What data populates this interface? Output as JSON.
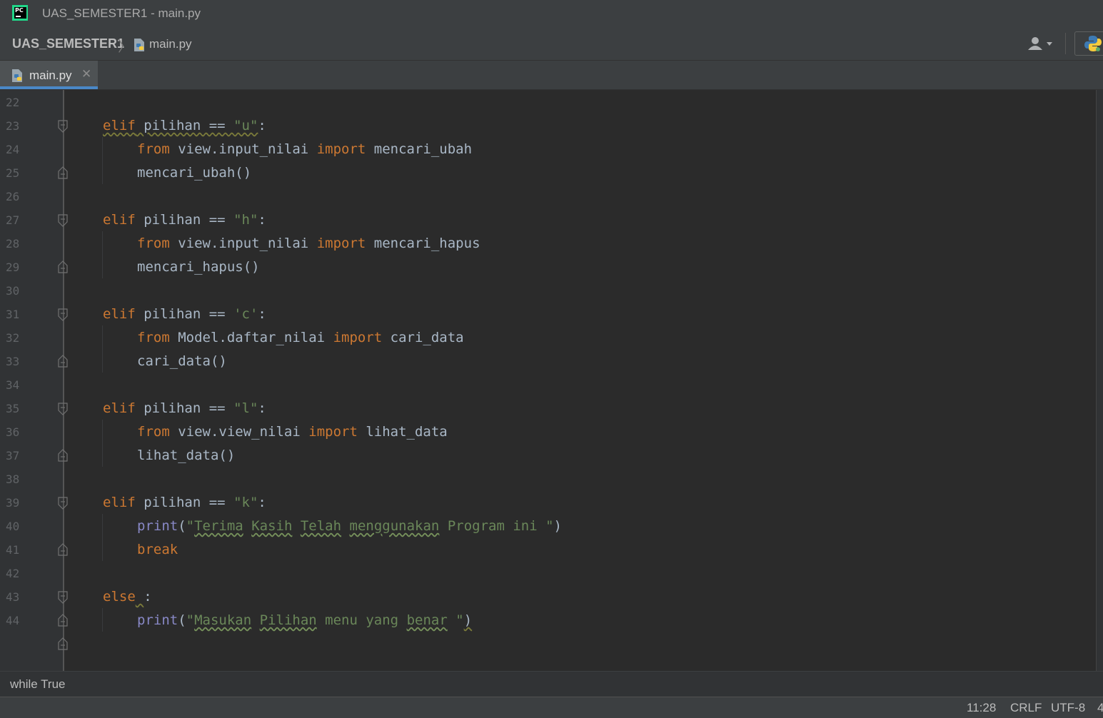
{
  "window": {
    "app_icon": "pycharm-logo-icon",
    "app_icon_text": "PC",
    "title": "UAS_SEMESTER1 - main.py"
  },
  "navbar": {
    "project": "UAS_SEMESTER1",
    "file": "main.py",
    "file_icon": "python-file-icon",
    "user_icon": "user-dropdown-icon",
    "interpreter_icon": "python-icon"
  },
  "tabs": [
    {
      "label": "main.py",
      "icon": "python-file-icon",
      "close": "✕",
      "active": true
    }
  ],
  "editor": {
    "line_numbers": [
      "22",
      "23",
      "24",
      "25",
      "26",
      "27",
      "28",
      "29",
      "30",
      "31",
      "32",
      "33",
      "34",
      "35",
      "36",
      "37",
      "38",
      "39",
      "40",
      "41",
      "42",
      "43",
      "44"
    ],
    "colors": {
      "background": "#2b2b2b",
      "keyword": "#cc7832",
      "string": "#6a8759",
      "builtin": "#8888c6",
      "default": "#a9b7c6",
      "line_number": "#606366"
    },
    "code": {
      "l23": {
        "kw": "elif",
        "rest": "pilihan == ",
        "str": "\"u\"",
        "end": ":"
      },
      "l24": {
        "kw1": "from",
        "mod": "view.input_nilai",
        "kw2": "import",
        "name": "mencari_ubah"
      },
      "l25": {
        "text": "mencari_ubah()"
      },
      "l27": {
        "kw": "elif",
        "rest": "pilihan == ",
        "str": "\"h\"",
        "end": ":"
      },
      "l28": {
        "kw1": "from",
        "mod": "view.input_nilai",
        "kw2": "import",
        "name": "mencari_hapus"
      },
      "l29": {
        "text": "mencari_hapus()"
      },
      "l31": {
        "kw": "elif",
        "rest": "pilihan == ",
        "str": "'c'",
        "end": ":"
      },
      "l32": {
        "kw1": "from",
        "mod": "Model.daftar_nilai",
        "kw2": "import",
        "name": "cari_data"
      },
      "l33": {
        "text": "cari_data()"
      },
      "l35": {
        "kw": "elif",
        "rest": "pilihan == ",
        "str": "\"l\"",
        "end": ":"
      },
      "l36": {
        "kw1": "from",
        "mod": "view.view_nilai",
        "kw2": "import",
        "name": "lihat_data"
      },
      "l37": {
        "text": "lihat_data()"
      },
      "l39": {
        "kw": "elif",
        "rest": "pilihan == ",
        "str": "\"k\"",
        "end": ":"
      },
      "l40": {
        "fn": "print",
        "open": "(",
        "q1": "\"",
        "w1": "Terima",
        "w2": "Kasih",
        "w3": "Telah",
        "w4": "menggunakan",
        "w5": "Program ini ",
        "q2": "\"",
        "close": ")"
      },
      "l41": {
        "kw": "break"
      },
      "l43": {
        "kw": "else",
        "end": ":"
      },
      "l44": {
        "fn": "print",
        "open": "(",
        "q1": "\"",
        "w1": "Masukan",
        "w2": "Pilihan",
        "w3": "menu yang",
        "w4": "benar",
        "sp": " ",
        "q2": "\"",
        "close": ")"
      }
    }
  },
  "breadcrumb": {
    "text": "while True"
  },
  "status": {
    "position": "11:28",
    "line_sep": "CRLF",
    "encoding": "UTF-8",
    "indent": "4"
  }
}
